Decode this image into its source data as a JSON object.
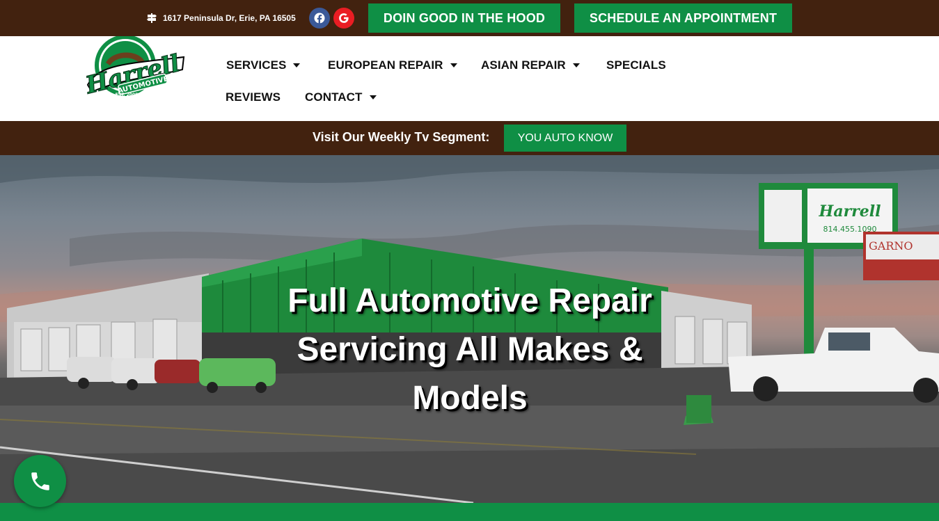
{
  "topbar": {
    "address": "1617 Peninsula Dr, Erie, PA 16505",
    "doin_good_label": "DOIN GOOD IN THE HOOD",
    "appointment_label": "SCHEDULE AN APPOINTMENT",
    "social": [
      "facebook-icon",
      "google-icon"
    ]
  },
  "logo": {
    "name": "Harrell",
    "sub": "AUTOMOTIVE",
    "tagline": "KEEPING YOU GET THERE",
    "est": "EST. 2005"
  },
  "nav": {
    "items": [
      {
        "label": "SERVICES",
        "dropdown": true
      },
      {
        "label": "EUROPEAN REPAIR",
        "dropdown": true
      },
      {
        "label": "ASIAN REPAIR",
        "dropdown": true
      },
      {
        "label": "SPECIALS",
        "dropdown": false
      },
      {
        "label": "REVIEWS",
        "dropdown": false
      },
      {
        "label": "CONTACT",
        "dropdown": true
      }
    ]
  },
  "tv": {
    "label": "Visit Our Weekly Tv Segment:",
    "button": "YOU AUTO KNOW"
  },
  "hero": {
    "line1": "Full Automotive Repair",
    "line2": "Servicing All Makes &",
    "line3": "Models"
  },
  "colors": {
    "brown": "#42220f",
    "green": "#0f8f45",
    "facebook": "#3b5998",
    "google": "#ea1d23"
  }
}
